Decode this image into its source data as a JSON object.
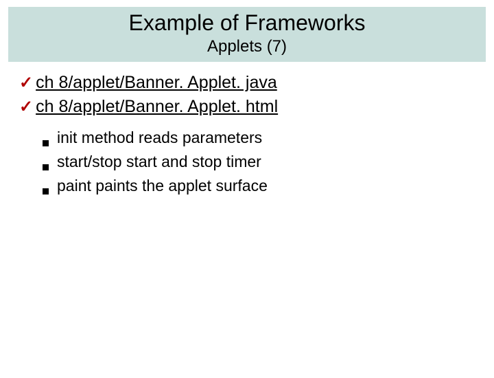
{
  "header": {
    "title": "Example of Frameworks",
    "subtitle": "Applets (7)"
  },
  "links": [
    "ch 8/applet/Banner. Applet. java",
    "ch 8/applet/Banner. Applet. html"
  ],
  "sub_points": [
    "init method reads parameters",
    "start/stop start and stop timer",
    "paint paints the applet surface"
  ]
}
